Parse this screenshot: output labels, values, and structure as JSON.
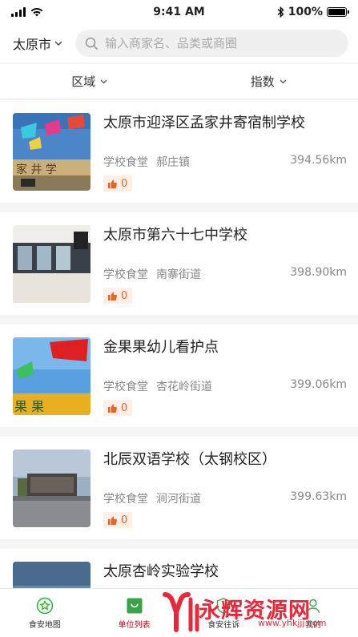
{
  "status": {
    "time": "9:41 AM",
    "battery": "100%"
  },
  "search": {
    "city": "太原市",
    "placeholder": "输入商家名、品类或商圈"
  },
  "filters": [
    {
      "label": "区域"
    },
    {
      "label": "指数"
    }
  ],
  "items": [
    {
      "name": "太原市迎泽区孟家井寄宿制学校",
      "category": "学校食堂",
      "area": "郝庄镇",
      "distance": "394.56km",
      "likes": "0"
    },
    {
      "name": "太原市第六十七中学校",
      "category": "学校食堂",
      "area": "南寨街道",
      "distance": "398.90km",
      "likes": "0"
    },
    {
      "name": "金果果幼儿看护点",
      "category": "学校食堂",
      "area": "杏花岭街道",
      "distance": "399.06km",
      "likes": "0"
    },
    {
      "name": "北辰双语学校（太钢校区）",
      "category": "学校食堂",
      "area": "涧河街道",
      "distance": "399.63km",
      "likes": "0"
    },
    {
      "name": "太原杏岭实验学校",
      "category": "",
      "area": "",
      "distance": "",
      "likes": ""
    }
  ],
  "tabs": [
    {
      "label": "食安地图",
      "icon": "star-badge-icon"
    },
    {
      "label": "单位列表",
      "icon": "shopping-bag-icon"
    },
    {
      "label": "食安往诉",
      "icon": "shield-icon"
    },
    {
      "label": "我的",
      "icon": "user-icon"
    }
  ],
  "watermark": {
    "text": "永辉资源网",
    "url": "www.yhkjjj.com"
  },
  "colors": {
    "accent": "#d0021b",
    "like": "#e8632a",
    "green": "#3aa545"
  }
}
